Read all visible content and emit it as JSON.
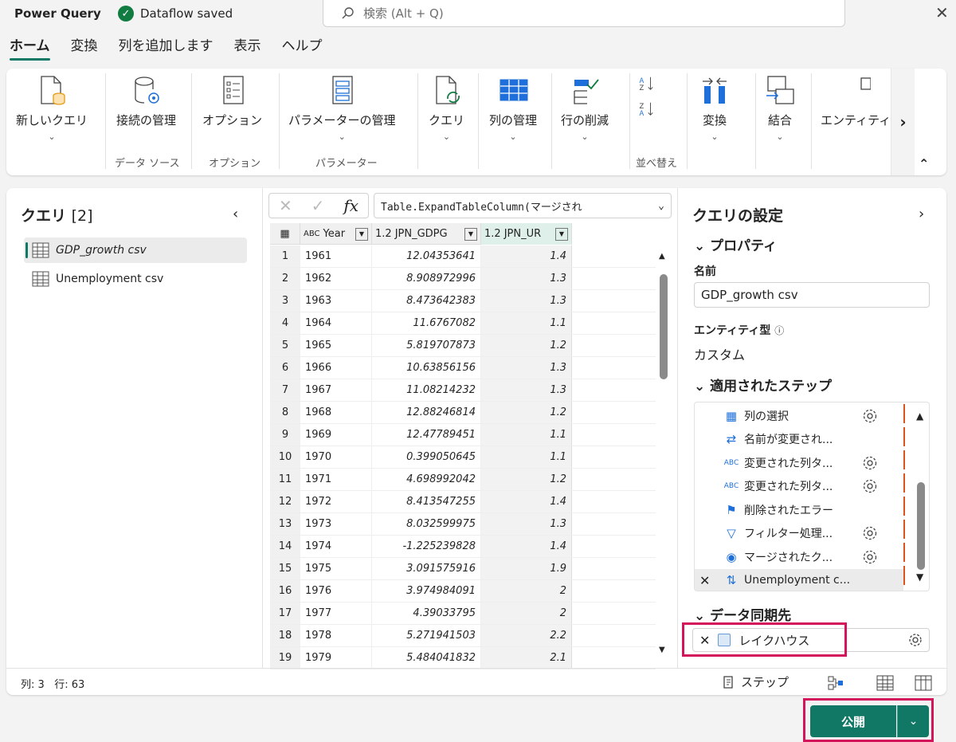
{
  "app": {
    "title": "Power Query",
    "status": "Dataflow saved",
    "search_placeholder": "検索 (Alt + Q)"
  },
  "tabs": [
    "ホーム",
    "変換",
    "列を追加します",
    "表示",
    "ヘルプ"
  ],
  "ribbon": {
    "new_query": "新しいクエリ",
    "manage_connections": "接続の管理",
    "options": "オプション",
    "manage_parameters": "パラメーターの管理",
    "query": "クエリ",
    "manage_columns": "列の管理",
    "reduce_rows": "行の削減",
    "transform": "変換",
    "combine": "結合",
    "entity": "エンティティ",
    "groups": {
      "data_source": "データ ソース",
      "options": "オプション",
      "parameters": "パラメーター",
      "sort": "並べ替え"
    }
  },
  "queries": {
    "title": "クエリ",
    "count": "[2]",
    "items": [
      "GDP_growth csv",
      "Unemployment csv"
    ]
  },
  "formula": {
    "fx": "fx",
    "expression": "Table.ExpandTableColumn(マージされ"
  },
  "table": {
    "columns": [
      {
        "type": "ABC",
        "name": "Year"
      },
      {
        "type": "1.2",
        "name": "JPN_GDPG"
      },
      {
        "type": "1.2",
        "name": "JPN_UR"
      }
    ],
    "rows": [
      [
        "1",
        "1961",
        "12.04353641",
        "1.4"
      ],
      [
        "2",
        "1962",
        "8.908972996",
        "1.3"
      ],
      [
        "3",
        "1963",
        "8.473642383",
        "1.3"
      ],
      [
        "4",
        "1964",
        "11.6767082",
        "1.1"
      ],
      [
        "5",
        "1965",
        "5.819707873",
        "1.2"
      ],
      [
        "6",
        "1966",
        "10.63856156",
        "1.3"
      ],
      [
        "7",
        "1967",
        "11.08214232",
        "1.3"
      ],
      [
        "8",
        "1968",
        "12.88246814",
        "1.2"
      ],
      [
        "9",
        "1969",
        "12.47789451",
        "1.1"
      ],
      [
        "10",
        "1970",
        "0.399050645",
        "1.1"
      ],
      [
        "11",
        "1971",
        "4.698992042",
        "1.2"
      ],
      [
        "12",
        "1972",
        "8.413547255",
        "1.4"
      ],
      [
        "13",
        "1973",
        "8.032599975",
        "1.3"
      ],
      [
        "14",
        "1974",
        "-1.225239828",
        "1.4"
      ],
      [
        "15",
        "1975",
        "3.091575916",
        "1.9"
      ],
      [
        "16",
        "1976",
        "3.974984091",
        "2"
      ],
      [
        "17",
        "1977",
        "4.39033795",
        "2"
      ],
      [
        "18",
        "1978",
        "5.271941503",
        "2.2"
      ],
      [
        "19",
        "1979",
        "5.484041832",
        "2.1"
      ]
    ]
  },
  "settings": {
    "title": "クエリの設定",
    "properties": "プロパティ",
    "name_label": "名前",
    "name_value": "GDP_growth csv",
    "entity_type_label": "エンティティ型",
    "entity_type_value": "カスタム",
    "applied_steps": "適用されたステップ",
    "steps": [
      "列の選択",
      "名前が変更され...",
      "変更された列タ...",
      "変更された列タ...",
      "削除されたエラー",
      "フィルター処理...",
      "マージされたク...",
      "Unemployment c..."
    ],
    "data_destination": "データ同期先",
    "destination_value": "レイクハウス"
  },
  "status": {
    "cols": "列: 3",
    "rows": "行: 63",
    "steps_button": "ステップ"
  },
  "publish": {
    "label": "公開"
  },
  "colors": {
    "accent": "#117865",
    "highlight": "#d4145a",
    "step_marker": "#d9541e"
  }
}
